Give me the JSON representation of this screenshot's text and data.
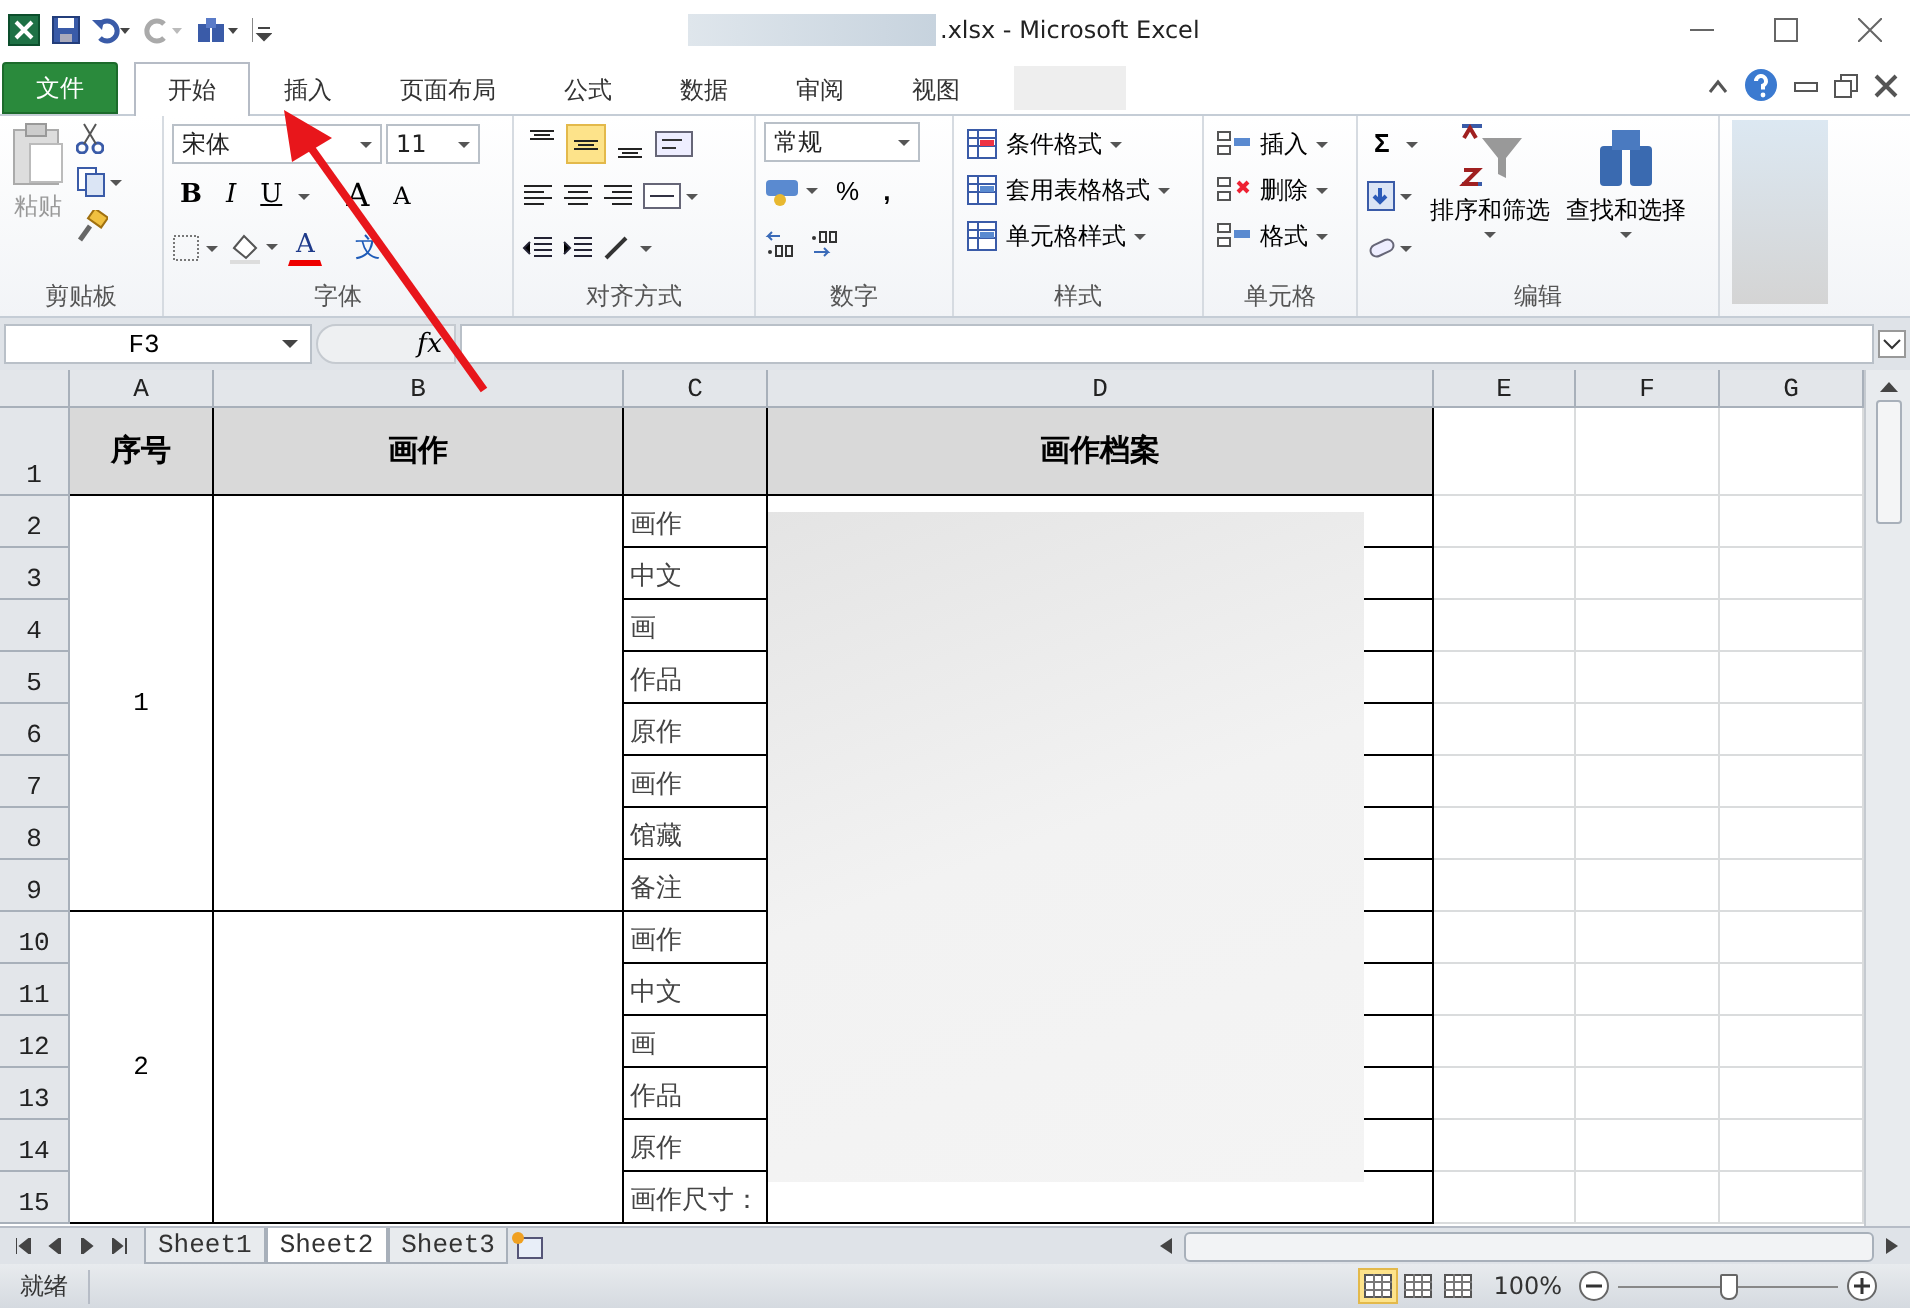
{
  "window": {
    "title": ".xlsx - Microsoft Excel"
  },
  "ribbon_tabs": [
    {
      "label": "文件",
      "kind": "file",
      "selected": false
    },
    {
      "label": "开始",
      "kind": "tab",
      "selected": true
    },
    {
      "label": "插入",
      "kind": "tab",
      "selected": false
    },
    {
      "label": "页面布局",
      "kind": "tab",
      "selected": false
    },
    {
      "label": "公式",
      "kind": "tab",
      "selected": false
    },
    {
      "label": "数据",
      "kind": "tab",
      "selected": false
    },
    {
      "label": "审阅",
      "kind": "tab",
      "selected": false
    },
    {
      "label": "视图",
      "kind": "tab",
      "selected": false
    }
  ],
  "ribbon": {
    "clipboard": {
      "label": "剪贴板",
      "paste": "粘贴"
    },
    "font": {
      "label": "字体",
      "font_name": "宋体",
      "font_size": "11",
      "bold": "B",
      "italic": "I",
      "underline": "U",
      "grow_font": "A",
      "shrink_font": "A",
      "font_color": "A",
      "phonetic": "文"
    },
    "alignment": {
      "label": "对齐方式",
      "vertical_align": [
        {
          "selected": false
        },
        {
          "selected": true
        },
        {
          "selected": false
        }
      ]
    },
    "number": {
      "label": "数字",
      "format": "常规",
      "percent": "%",
      "comma": ","
    },
    "styles": {
      "label": "样式",
      "items": [
        "条件格式",
        "套用表格格式",
        "单元格样式"
      ]
    },
    "cells": {
      "label": "单元格",
      "items": [
        "插入",
        "删除",
        "格式"
      ]
    },
    "editing": {
      "label": "编辑",
      "sum": "Σ",
      "sort": "排序和筛选",
      "find": "查找和选择"
    }
  },
  "formula_bar": {
    "name_box": "F3",
    "function_label": "fx"
  },
  "sheet": {
    "columns": [
      "A",
      "B",
      "C",
      "D",
      "E",
      "F",
      "G"
    ],
    "rows": [
      "1",
      "2",
      "3",
      "4",
      "5",
      "6",
      "7",
      "8",
      "9",
      "10",
      "11",
      "12",
      "13",
      "14",
      "15"
    ],
    "header": [
      "序号",
      "画作",
      "画作档案"
    ],
    "groups": [
      {
        "number": "1",
        "labels": [
          "画作",
          "中文",
          "画 ",
          "作品",
          "原作",
          "画作",
          "馆藏",
          "备注"
        ]
      },
      {
        "number": "2",
        "labels": [
          "画作",
          "中文",
          "画 ",
          "作品",
          "原作",
          "画作尺寸："
        ]
      }
    ]
  },
  "sheet_tabs": [
    {
      "label": "Sheet1",
      "selected": false
    },
    {
      "label": "Sheet2",
      "selected": true
    },
    {
      "label": "Sheet3",
      "selected": false
    }
  ],
  "status_bar": {
    "status": "就绪",
    "views": [
      {
        "selected": true
      },
      {
        "selected": false
      },
      {
        "selected": false
      }
    ],
    "zoom": "100%",
    "zoom_slider": {
      "level": 0.5
    }
  }
}
